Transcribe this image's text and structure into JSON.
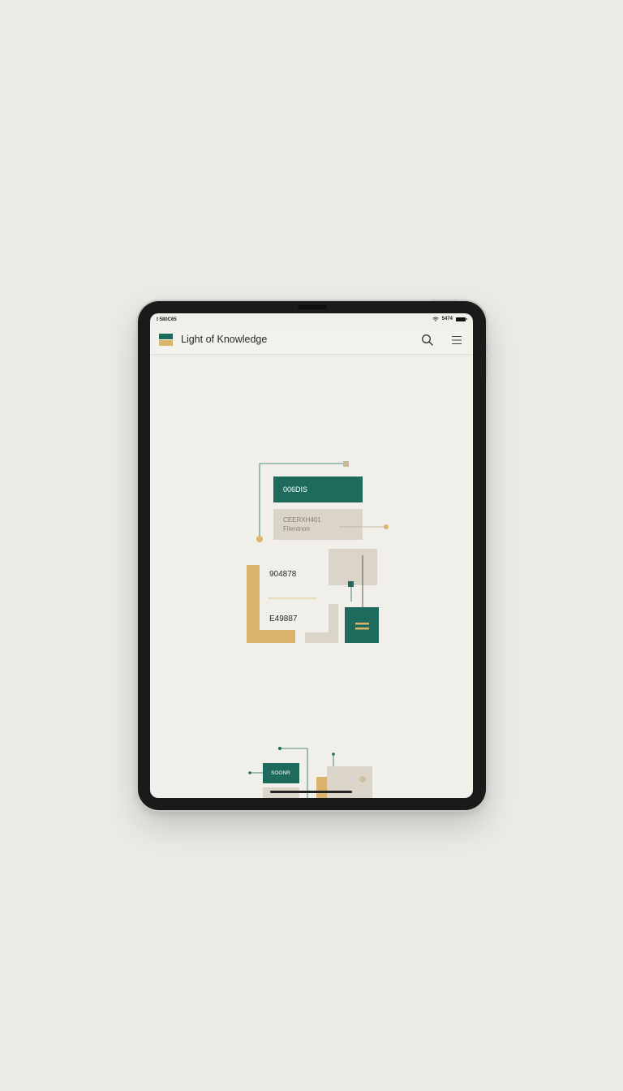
{
  "status_bar": {
    "left_text": "t 580C65",
    "right_text": "5474"
  },
  "app_bar": {
    "title": "Light of Knowledge",
    "search_icon": "search-icon",
    "menu_icon": "hamburger-menu-icon"
  },
  "illustration": {
    "top_bar_label": "006DIS",
    "card_line1": "CEERXH401",
    "card_line2": "Filentnon",
    "number1": "904878",
    "number2": "E49887",
    "bottom_bar_label": "SOONR"
  },
  "colors": {
    "teal": "#1e6b5e",
    "gold": "#dcb36c",
    "beige": "#dad5c8",
    "background": "#f1efea"
  }
}
